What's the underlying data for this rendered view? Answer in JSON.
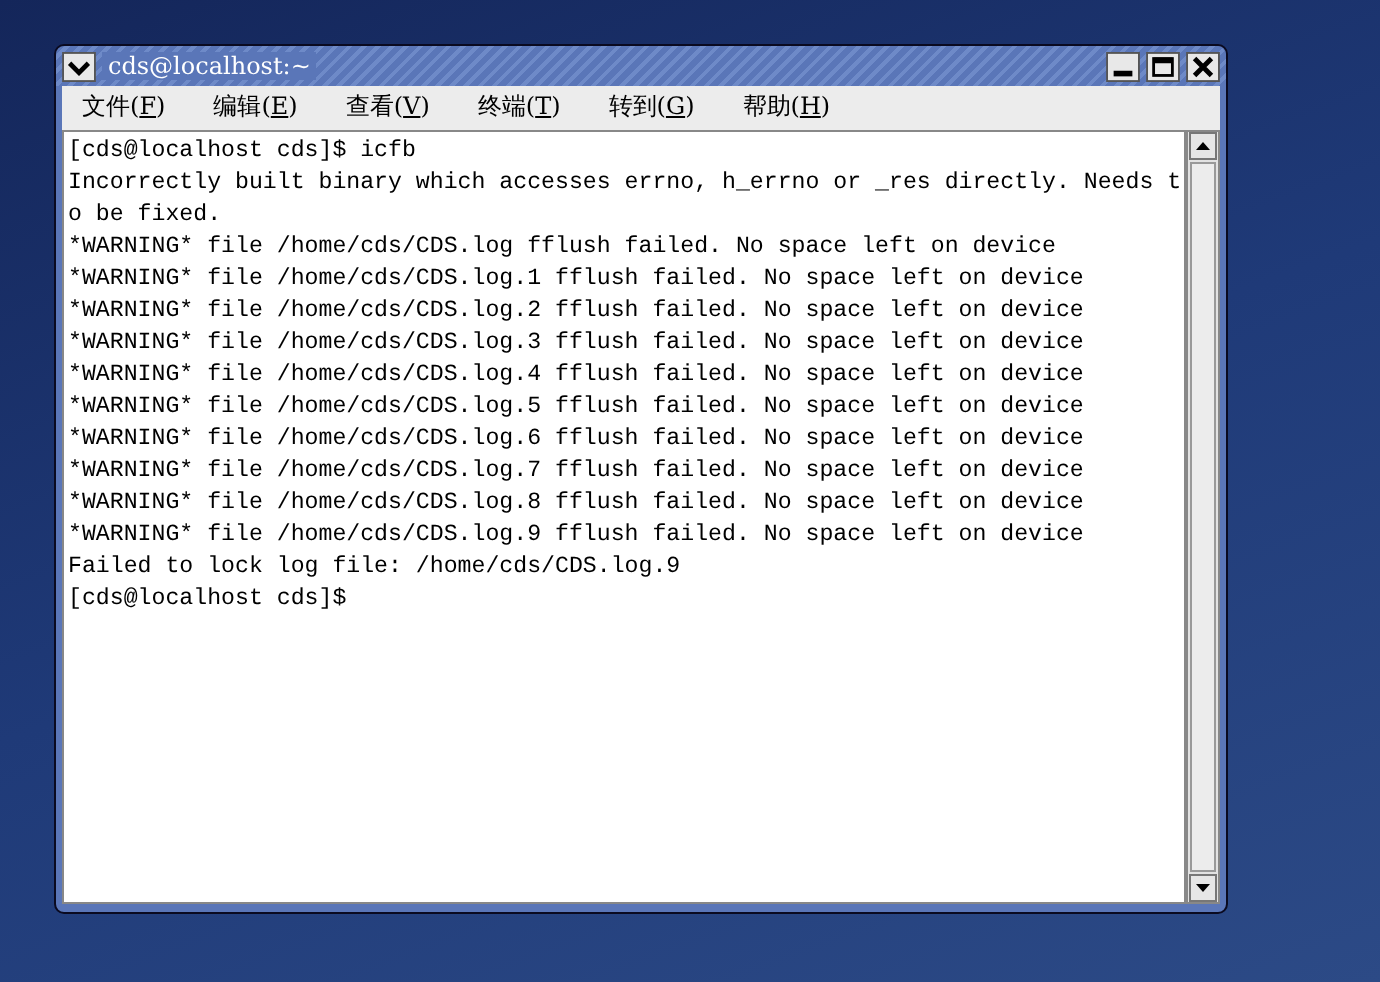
{
  "window": {
    "title": "cds@localhost:~"
  },
  "menu": [
    {
      "before": "文件(",
      "key": "F",
      "after": ")"
    },
    {
      "before": "编辑(",
      "key": "E",
      "after": ")"
    },
    {
      "before": "查看(",
      "key": "V",
      "after": ")"
    },
    {
      "before": "终端(",
      "key": "T",
      "after": ")"
    },
    {
      "before": "转到(",
      "key": "G",
      "after": ")"
    },
    {
      "before": "帮助(",
      "key": "H",
      "after": ")"
    }
  ],
  "terminal": {
    "lines": [
      "[cds@localhost cds]$ icfb",
      "Incorrectly built binary which accesses errno, h_errno or _res directly. Needs t",
      "o be fixed.",
      "*WARNING* file /home/cds/CDS.log fflush failed. No space left on device",
      "*WARNING* file /home/cds/CDS.log.1 fflush failed. No space left on device",
      "*WARNING* file /home/cds/CDS.log.2 fflush failed. No space left on device",
      "*WARNING* file /home/cds/CDS.log.3 fflush failed. No space left on device",
      "*WARNING* file /home/cds/CDS.log.4 fflush failed. No space left on device",
      "*WARNING* file /home/cds/CDS.log.5 fflush failed. No space left on device",
      "*WARNING* file /home/cds/CDS.log.6 fflush failed. No space left on device",
      "*WARNING* file /home/cds/CDS.log.7 fflush failed. No space left on device",
      "*WARNING* file /home/cds/CDS.log.8 fflush failed. No space left on device",
      "*WARNING* file /home/cds/CDS.log.9 fflush failed. No space left on device",
      "Failed to lock log file: /home/cds/CDS.log.9",
      "[cds@localhost cds]$"
    ]
  }
}
